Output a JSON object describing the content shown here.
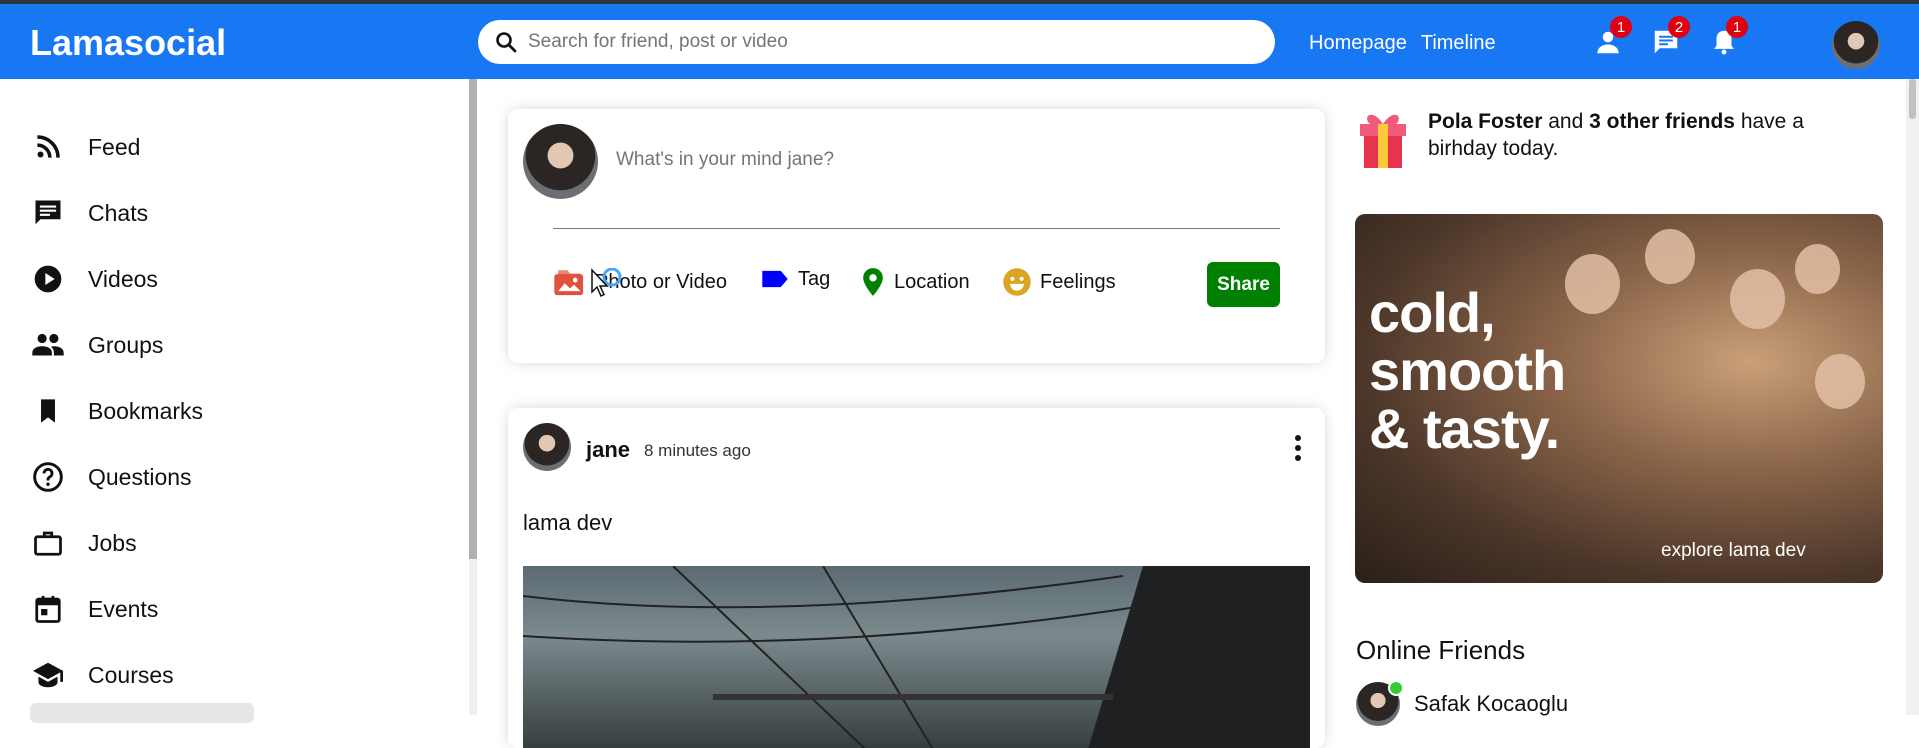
{
  "topbar": {
    "logo": "Lamasocial",
    "search_placeholder": "Search for friend, post or video",
    "links": [
      "Homepage",
      "Timeline"
    ],
    "badges": {
      "friends": "1",
      "messages": "2",
      "notifications": "1"
    }
  },
  "sidebar": {
    "items": [
      {
        "label": "Feed",
        "icon": "rss-icon"
      },
      {
        "label": "Chats",
        "icon": "chat-icon"
      },
      {
        "label": "Videos",
        "icon": "play-circle-icon"
      },
      {
        "label": "Groups",
        "icon": "group-icon"
      },
      {
        "label": "Bookmarks",
        "icon": "bookmark-icon"
      },
      {
        "label": "Questions",
        "icon": "help-circle-icon"
      },
      {
        "label": "Jobs",
        "icon": "briefcase-icon"
      },
      {
        "label": "Events",
        "icon": "calendar-icon"
      },
      {
        "label": "Courses",
        "icon": "school-icon"
      }
    ]
  },
  "share": {
    "placeholder": "What's in your mind jane?",
    "options": [
      {
        "label": "Photo or Video",
        "color": "#e0523e",
        "icon": "photo-icon"
      },
      {
        "label": "Tag",
        "color": "#0000ff",
        "icon": "label-icon"
      },
      {
        "label": "Location",
        "color": "#008000",
        "icon": "location-pin-icon"
      },
      {
        "label": "Feelings",
        "color": "#daa520",
        "icon": "emoji-icon"
      }
    ],
    "button": "Share"
  },
  "post": {
    "username": "jane",
    "time": "8 minutes ago",
    "text": "lama dev"
  },
  "rightbar": {
    "birthday": {
      "name": "Pola Foster",
      "and": "and",
      "others": "3 other friends",
      "rest": "have a birhday today."
    },
    "ad": {
      "headline_1": "cold,",
      "headline_2": "smooth",
      "headline_3": "& tasty.",
      "footer": "explore lama dev"
    },
    "online_title": "Online Friends",
    "friends": [
      {
        "name": "Safak Kocaoglu"
      }
    ]
  },
  "colors": {
    "topbar": "#1877f2",
    "share_button": "#008000",
    "badge": "#e0000f",
    "online": "#32cd32"
  }
}
